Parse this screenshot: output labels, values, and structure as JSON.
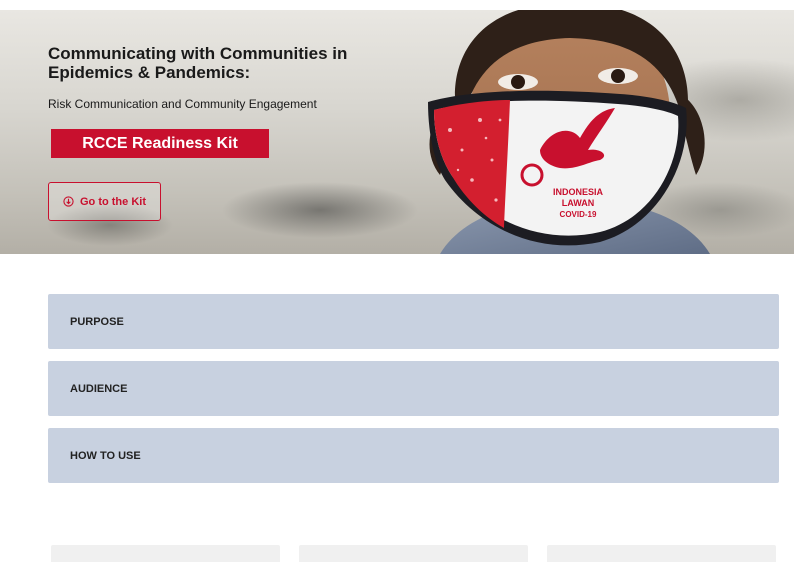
{
  "hero": {
    "title_line1": "Communicating with Communities in",
    "title_line2": "Epidemics & Pandemics:",
    "subtitle": "Risk Communication and Community Engagement",
    "kit_banner": "RCCE Readiness Kit",
    "go_button": "Go to the Kit",
    "mask_text": [
      "INDONESIA",
      "LAWAN",
      "COVID-19"
    ]
  },
  "accordion": [
    {
      "label": "PURPOSE"
    },
    {
      "label": "AUDIENCE"
    },
    {
      "label": "HOW TO USE"
    }
  ],
  "colors": {
    "brand_red": "#c8102e",
    "accordion_bg": "#c8d1e0"
  }
}
